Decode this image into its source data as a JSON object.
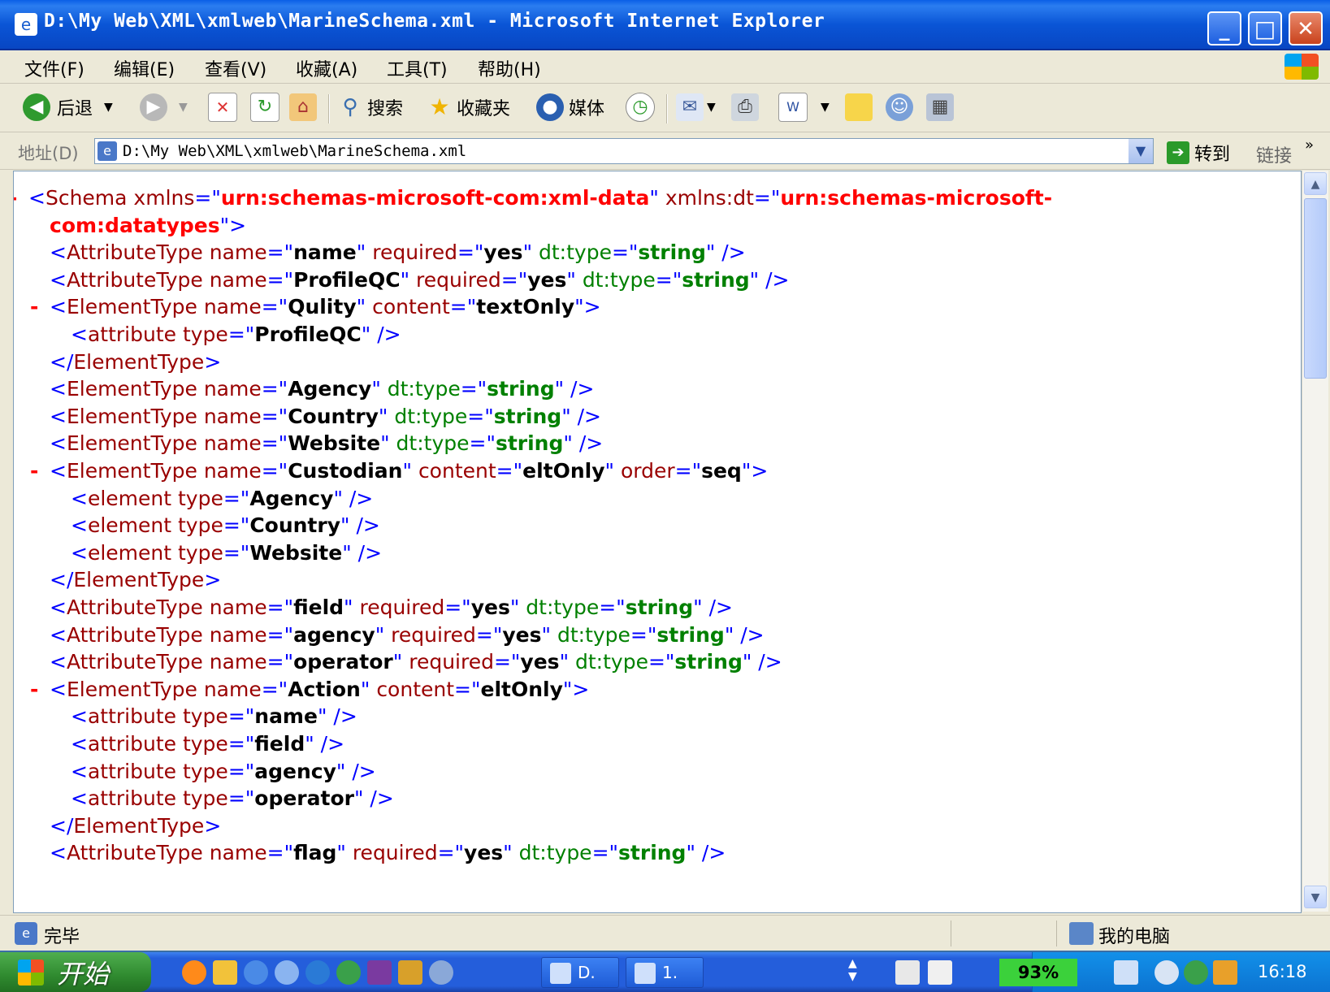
{
  "window": {
    "title": "D:\\My Web\\XML\\xmlweb\\MarineSchema.xml - Microsoft Internet Explorer",
    "minimize": "_",
    "maximize": "□",
    "close": "✕"
  },
  "menu": [
    "文件(F)",
    "编辑(E)",
    "查看(V)",
    "收藏(A)",
    "工具(T)",
    "帮助(H)"
  ],
  "toolbar": {
    "back": "后退",
    "search": "搜索",
    "favorites": "收藏夹",
    "media": "媒体"
  },
  "address": {
    "label": "地址(D)",
    "value": "D:\\My Web\\XML\\xmlweb\\MarineSchema.xml",
    "go": "转到",
    "links": "链接",
    "more": "»"
  },
  "xml_lines": [
    {
      "indent": 0,
      "marker": "-",
      "parts": [
        {
          "c": "b",
          "t": "<"
        },
        {
          "c": "t",
          "t": "Schema "
        },
        {
          "c": "an",
          "t": "xmlns"
        },
        {
          "c": "b",
          "t": "=\""
        },
        {
          "c": "ns",
          "t": "urn:schemas-microsoft-com:xml-data"
        },
        {
          "c": "b",
          "t": "\" "
        },
        {
          "c": "an",
          "t": "xmlns:dt"
        },
        {
          "c": "b",
          "t": "=\""
        },
        {
          "c": "ns",
          "t": "urn:schemas-microsoft-"
        }
      ]
    },
    {
      "indent": 1,
      "parts": [
        {
          "c": "ns",
          "t": "com:datatypes"
        },
        {
          "c": "b",
          "t": "\">"
        }
      ]
    },
    {
      "indent": 1,
      "parts": [
        {
          "c": "b",
          "t": "<"
        },
        {
          "c": "t",
          "t": "AttributeType "
        },
        {
          "c": "an",
          "t": "name"
        },
        {
          "c": "b",
          "t": "=\""
        },
        {
          "c": "av",
          "t": "name"
        },
        {
          "c": "b",
          "t": "\" "
        },
        {
          "c": "an",
          "t": "required"
        },
        {
          "c": "b",
          "t": "=\""
        },
        {
          "c": "av",
          "t": "yes"
        },
        {
          "c": "b",
          "t": "\" "
        },
        {
          "c": "dn",
          "t": "dt:type"
        },
        {
          "c": "b",
          "t": "=\""
        },
        {
          "c": "dv",
          "t": "string"
        },
        {
          "c": "b",
          "t": "\" />"
        }
      ]
    },
    {
      "indent": 1,
      "parts": [
        {
          "c": "b",
          "t": "<"
        },
        {
          "c": "t",
          "t": "AttributeType "
        },
        {
          "c": "an",
          "t": "name"
        },
        {
          "c": "b",
          "t": "=\""
        },
        {
          "c": "av",
          "t": "ProfileQC"
        },
        {
          "c": "b",
          "t": "\" "
        },
        {
          "c": "an",
          "t": "required"
        },
        {
          "c": "b",
          "t": "=\""
        },
        {
          "c": "av",
          "t": "yes"
        },
        {
          "c": "b",
          "t": "\" "
        },
        {
          "c": "dn",
          "t": "dt:type"
        },
        {
          "c": "b",
          "t": "=\""
        },
        {
          "c": "dv",
          "t": "string"
        },
        {
          "c": "b",
          "t": "\" />"
        }
      ]
    },
    {
      "indent": 1,
      "marker": "-",
      "parts": [
        {
          "c": "b",
          "t": "<"
        },
        {
          "c": "t",
          "t": "ElementType "
        },
        {
          "c": "an",
          "t": "name"
        },
        {
          "c": "b",
          "t": "=\""
        },
        {
          "c": "av",
          "t": "Qulity"
        },
        {
          "c": "b",
          "t": "\" "
        },
        {
          "c": "an",
          "t": "content"
        },
        {
          "c": "b",
          "t": "=\""
        },
        {
          "c": "av",
          "t": "textOnly"
        },
        {
          "c": "b",
          "t": "\">"
        }
      ]
    },
    {
      "indent": 2,
      "parts": [
        {
          "c": "b",
          "t": "<"
        },
        {
          "c": "t",
          "t": "attribute "
        },
        {
          "c": "an",
          "t": "type"
        },
        {
          "c": "b",
          "t": "=\""
        },
        {
          "c": "av",
          "t": "ProfileQC"
        },
        {
          "c": "b",
          "t": "\" />"
        }
      ]
    },
    {
      "indent": 1,
      "parts": [
        {
          "c": "b",
          "t": "</"
        },
        {
          "c": "t",
          "t": "ElementType"
        },
        {
          "c": "b",
          "t": ">"
        }
      ]
    },
    {
      "indent": 1,
      "parts": [
        {
          "c": "b",
          "t": "<"
        },
        {
          "c": "t",
          "t": "ElementType "
        },
        {
          "c": "an",
          "t": "name"
        },
        {
          "c": "b",
          "t": "=\""
        },
        {
          "c": "av",
          "t": "Agency"
        },
        {
          "c": "b",
          "t": "\" "
        },
        {
          "c": "dn",
          "t": "dt:type"
        },
        {
          "c": "b",
          "t": "=\""
        },
        {
          "c": "dv",
          "t": "string"
        },
        {
          "c": "b",
          "t": "\" />"
        }
      ]
    },
    {
      "indent": 1,
      "parts": [
        {
          "c": "b",
          "t": "<"
        },
        {
          "c": "t",
          "t": "ElementType "
        },
        {
          "c": "an",
          "t": "name"
        },
        {
          "c": "b",
          "t": "=\""
        },
        {
          "c": "av",
          "t": "Country"
        },
        {
          "c": "b",
          "t": "\" "
        },
        {
          "c": "dn",
          "t": "dt:type"
        },
        {
          "c": "b",
          "t": "=\""
        },
        {
          "c": "dv",
          "t": "string"
        },
        {
          "c": "b",
          "t": "\" />"
        }
      ]
    },
    {
      "indent": 1,
      "parts": [
        {
          "c": "b",
          "t": "<"
        },
        {
          "c": "t",
          "t": "ElementType "
        },
        {
          "c": "an",
          "t": "name"
        },
        {
          "c": "b",
          "t": "=\""
        },
        {
          "c": "av",
          "t": "Website"
        },
        {
          "c": "b",
          "t": "\" "
        },
        {
          "c": "dn",
          "t": "dt:type"
        },
        {
          "c": "b",
          "t": "=\""
        },
        {
          "c": "dv",
          "t": "string"
        },
        {
          "c": "b",
          "t": "\" />"
        }
      ]
    },
    {
      "indent": 1,
      "marker": "-",
      "parts": [
        {
          "c": "b",
          "t": "<"
        },
        {
          "c": "t",
          "t": "ElementType "
        },
        {
          "c": "an",
          "t": "name"
        },
        {
          "c": "b",
          "t": "=\""
        },
        {
          "c": "av",
          "t": "Custodian"
        },
        {
          "c": "b",
          "t": "\" "
        },
        {
          "c": "an",
          "t": "content"
        },
        {
          "c": "b",
          "t": "=\""
        },
        {
          "c": "av",
          "t": "eltOnly"
        },
        {
          "c": "b",
          "t": "\" "
        },
        {
          "c": "an",
          "t": "order"
        },
        {
          "c": "b",
          "t": "=\""
        },
        {
          "c": "av",
          "t": "seq"
        },
        {
          "c": "b",
          "t": "\">"
        }
      ]
    },
    {
      "indent": 2,
      "parts": [
        {
          "c": "b",
          "t": "<"
        },
        {
          "c": "t",
          "t": "element "
        },
        {
          "c": "an",
          "t": "type"
        },
        {
          "c": "b",
          "t": "=\""
        },
        {
          "c": "av",
          "t": "Agency"
        },
        {
          "c": "b",
          "t": "\" />"
        }
      ]
    },
    {
      "indent": 2,
      "parts": [
        {
          "c": "b",
          "t": "<"
        },
        {
          "c": "t",
          "t": "element "
        },
        {
          "c": "an",
          "t": "type"
        },
        {
          "c": "b",
          "t": "=\""
        },
        {
          "c": "av",
          "t": "Country"
        },
        {
          "c": "b",
          "t": "\" />"
        }
      ]
    },
    {
      "indent": 2,
      "parts": [
        {
          "c": "b",
          "t": "<"
        },
        {
          "c": "t",
          "t": "element "
        },
        {
          "c": "an",
          "t": "type"
        },
        {
          "c": "b",
          "t": "=\""
        },
        {
          "c": "av",
          "t": "Website"
        },
        {
          "c": "b",
          "t": "\" />"
        }
      ]
    },
    {
      "indent": 1,
      "parts": [
        {
          "c": "b",
          "t": "</"
        },
        {
          "c": "t",
          "t": "ElementType"
        },
        {
          "c": "b",
          "t": ">"
        }
      ]
    },
    {
      "indent": 1,
      "parts": [
        {
          "c": "b",
          "t": "<"
        },
        {
          "c": "t",
          "t": "AttributeType "
        },
        {
          "c": "an",
          "t": "name"
        },
        {
          "c": "b",
          "t": "=\""
        },
        {
          "c": "av",
          "t": "field"
        },
        {
          "c": "b",
          "t": "\" "
        },
        {
          "c": "an",
          "t": "required"
        },
        {
          "c": "b",
          "t": "=\""
        },
        {
          "c": "av",
          "t": "yes"
        },
        {
          "c": "b",
          "t": "\" "
        },
        {
          "c": "dn",
          "t": "dt:type"
        },
        {
          "c": "b",
          "t": "=\""
        },
        {
          "c": "dv",
          "t": "string"
        },
        {
          "c": "b",
          "t": "\" />"
        }
      ]
    },
    {
      "indent": 1,
      "parts": [
        {
          "c": "b",
          "t": "<"
        },
        {
          "c": "t",
          "t": "AttributeType "
        },
        {
          "c": "an",
          "t": "name"
        },
        {
          "c": "b",
          "t": "=\""
        },
        {
          "c": "av",
          "t": "agency"
        },
        {
          "c": "b",
          "t": "\" "
        },
        {
          "c": "an",
          "t": "required"
        },
        {
          "c": "b",
          "t": "=\""
        },
        {
          "c": "av",
          "t": "yes"
        },
        {
          "c": "b",
          "t": "\" "
        },
        {
          "c": "dn",
          "t": "dt:type"
        },
        {
          "c": "b",
          "t": "=\""
        },
        {
          "c": "dv",
          "t": "string"
        },
        {
          "c": "b",
          "t": "\" />"
        }
      ]
    },
    {
      "indent": 1,
      "parts": [
        {
          "c": "b",
          "t": "<"
        },
        {
          "c": "t",
          "t": "AttributeType "
        },
        {
          "c": "an",
          "t": "name"
        },
        {
          "c": "b",
          "t": "=\""
        },
        {
          "c": "av",
          "t": "operator"
        },
        {
          "c": "b",
          "t": "\" "
        },
        {
          "c": "an",
          "t": "required"
        },
        {
          "c": "b",
          "t": "=\""
        },
        {
          "c": "av",
          "t": "yes"
        },
        {
          "c": "b",
          "t": "\" "
        },
        {
          "c": "dn",
          "t": "dt:type"
        },
        {
          "c": "b",
          "t": "=\""
        },
        {
          "c": "dv",
          "t": "string"
        },
        {
          "c": "b",
          "t": "\" />"
        }
      ]
    },
    {
      "indent": 1,
      "marker": "-",
      "parts": [
        {
          "c": "b",
          "t": "<"
        },
        {
          "c": "t",
          "t": "ElementType "
        },
        {
          "c": "an",
          "t": "name"
        },
        {
          "c": "b",
          "t": "=\""
        },
        {
          "c": "av",
          "t": "Action"
        },
        {
          "c": "b",
          "t": "\" "
        },
        {
          "c": "an",
          "t": "content"
        },
        {
          "c": "b",
          "t": "=\""
        },
        {
          "c": "av",
          "t": "eltOnly"
        },
        {
          "c": "b",
          "t": "\">"
        }
      ]
    },
    {
      "indent": 2,
      "parts": [
        {
          "c": "b",
          "t": "<"
        },
        {
          "c": "t",
          "t": "attribute "
        },
        {
          "c": "an",
          "t": "type"
        },
        {
          "c": "b",
          "t": "=\""
        },
        {
          "c": "av",
          "t": "name"
        },
        {
          "c": "b",
          "t": "\" />"
        }
      ]
    },
    {
      "indent": 2,
      "parts": [
        {
          "c": "b",
          "t": "<"
        },
        {
          "c": "t",
          "t": "attribute "
        },
        {
          "c": "an",
          "t": "type"
        },
        {
          "c": "b",
          "t": "=\""
        },
        {
          "c": "av",
          "t": "field"
        },
        {
          "c": "b",
          "t": "\" />"
        }
      ]
    },
    {
      "indent": 2,
      "parts": [
        {
          "c": "b",
          "t": "<"
        },
        {
          "c": "t",
          "t": "attribute "
        },
        {
          "c": "an",
          "t": "type"
        },
        {
          "c": "b",
          "t": "=\""
        },
        {
          "c": "av",
          "t": "agency"
        },
        {
          "c": "b",
          "t": "\" />"
        }
      ]
    },
    {
      "indent": 2,
      "parts": [
        {
          "c": "b",
          "t": "<"
        },
        {
          "c": "t",
          "t": "attribute "
        },
        {
          "c": "an",
          "t": "type"
        },
        {
          "c": "b",
          "t": "=\""
        },
        {
          "c": "av",
          "t": "operator"
        },
        {
          "c": "b",
          "t": "\" />"
        }
      ]
    },
    {
      "indent": 1,
      "parts": [
        {
          "c": "b",
          "t": "</"
        },
        {
          "c": "t",
          "t": "ElementType"
        },
        {
          "c": "b",
          "t": ">"
        }
      ]
    },
    {
      "indent": 1,
      "parts": [
        {
          "c": "b",
          "t": "<"
        },
        {
          "c": "t",
          "t": "AttributeType "
        },
        {
          "c": "an",
          "t": "name"
        },
        {
          "c": "b",
          "t": "=\""
        },
        {
          "c": "av",
          "t": "flag"
        },
        {
          "c": "b",
          "t": "\" "
        },
        {
          "c": "an",
          "t": "required"
        },
        {
          "c": "b",
          "t": "=\""
        },
        {
          "c": "av",
          "t": "yes"
        },
        {
          "c": "b",
          "t": "\" "
        },
        {
          "c": "dn",
          "t": "dt:type"
        },
        {
          "c": "b",
          "t": "=\""
        },
        {
          "c": "dv",
          "t": "string"
        },
        {
          "c": "b",
          "t": "\" />"
        }
      ]
    }
  ],
  "status": {
    "text": "完毕",
    "zone": "我的电脑"
  },
  "taskbar": {
    "start": "开始",
    "tasks": [
      "D.",
      "1."
    ],
    "battery": "93%",
    "clock": "16:18"
  },
  "colors": {
    "markup_blue": "#0000ff",
    "tag_name": "#990000",
    "attr_value": "#000000",
    "namespace_value": "#ff0000",
    "dt_value": "#008000",
    "titlebar": "#0a55d6"
  },
  "icons": [
    "ie-page-icon",
    "back-arrow-icon",
    "forward-arrow-icon",
    "stop-icon",
    "refresh-icon",
    "home-icon",
    "search-icon",
    "favorites-star-icon",
    "media-icon",
    "history-icon",
    "mail-icon",
    "print-icon",
    "edit-icon",
    "discuss-icon",
    "messenger-icon",
    "research-icon",
    "windows-flag-icon",
    "my-computer-icon"
  ]
}
